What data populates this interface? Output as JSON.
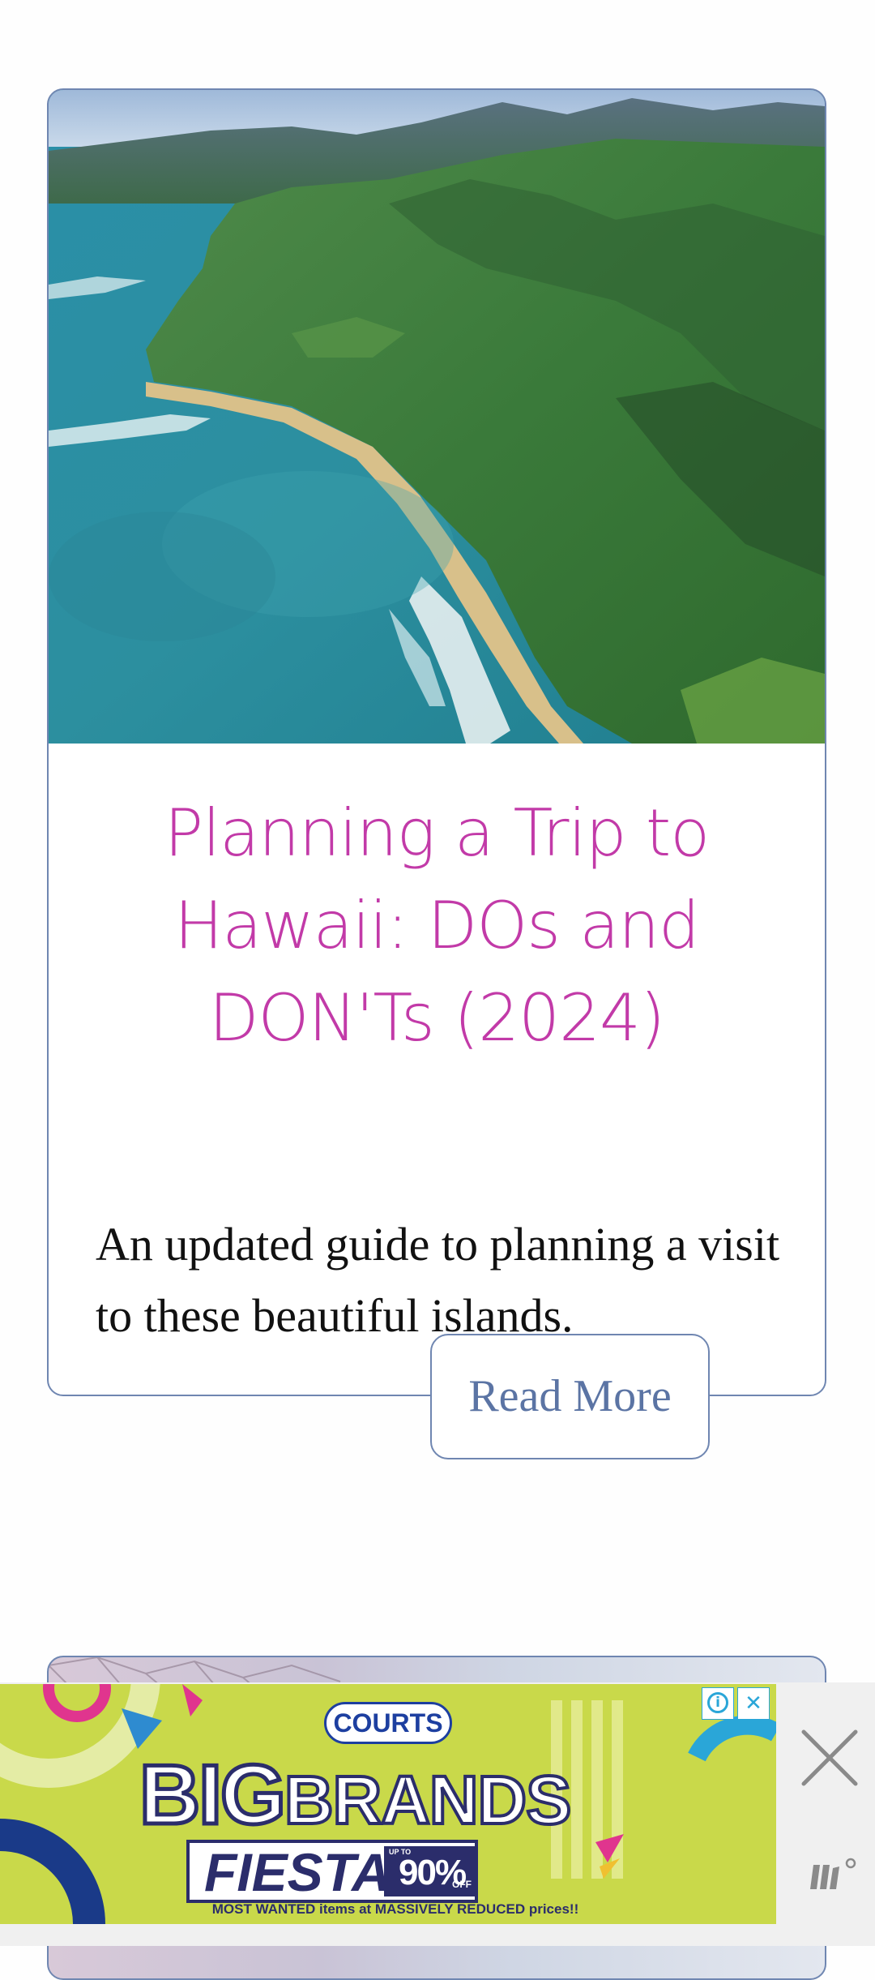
{
  "article": {
    "image_alt": "Aerial view of Hawaii coastline with mountains",
    "title": "Planning a Trip to Hawaii: DOs and DON'Ts (2024)",
    "description": "An updated guide to planning a visit to these beautiful islands.",
    "read_more_label": "Read More"
  },
  "ad": {
    "brand": "COURTS",
    "headline_big": "BIG",
    "headline_brands": "BRANDS",
    "headline_fiesta": "FIESTA",
    "discount_upto": "UP TO",
    "discount_value": "90%",
    "discount_off": "OFF",
    "tagline": "MOST WANTED items at MASSIVELY REDUCED prices!!",
    "adchoices_label": "i",
    "close_label": "✕"
  },
  "colors": {
    "title": "#c23aa8",
    "card_border": "#6f86b1",
    "button_text": "#5b74a4",
    "ad_background": "#c9d94a"
  },
  "icons": {
    "ad_close": "close-icon",
    "ad_choices": "info-icon",
    "ad_network": "brand-mark-icon"
  }
}
